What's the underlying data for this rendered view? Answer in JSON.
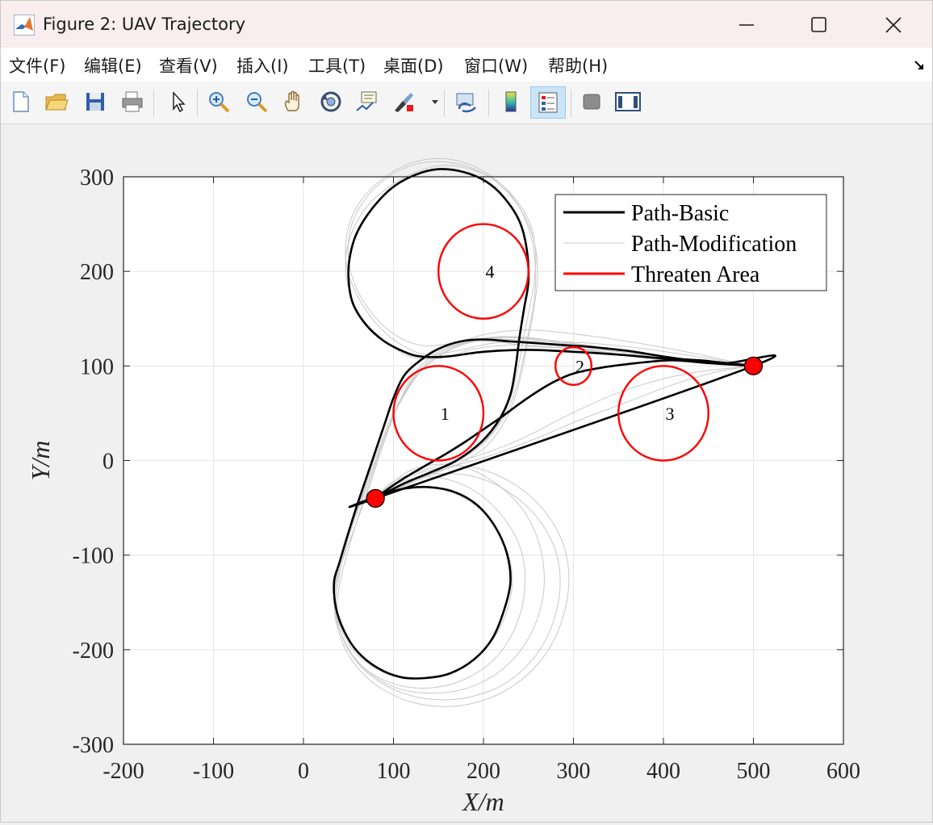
{
  "window": {
    "title": "Figure 2: UAV Trajectory"
  },
  "menu": [
    "文件(F)",
    "编辑(E)",
    "查看(V)",
    "插入(I)",
    "工具(T)",
    "桌面(D)",
    "窗口(W)",
    "帮助(H)"
  ],
  "toolbar": [
    "new-file-icon",
    "open-folder-icon",
    "save-icon",
    "print-icon",
    "pointer-icon",
    "zoom-in-icon",
    "zoom-out-icon",
    "pan-hand-icon",
    "rotate-3d-icon",
    "data-cursor-icon",
    "brush-icon",
    "link-plot-icon",
    "colorbar-icon",
    "legend-icon",
    "hide-plot-tools-icon",
    "show-plot-tools-icon"
  ],
  "chart_data": {
    "type": "line",
    "xlabel": "X/m",
    "ylabel": "Y/m",
    "xlim": [
      -200,
      600
    ],
    "ylim": [
      -300,
      300
    ],
    "xticks": [
      -200,
      -100,
      0,
      100,
      200,
      300,
      400,
      500,
      600
    ],
    "yticks": [
      -300,
      -200,
      -100,
      0,
      100,
      200,
      300
    ],
    "grid": true,
    "legend_position": "top-right",
    "legend": [
      {
        "label": "Path-Basic",
        "color": "#000000"
      },
      {
        "label": "Path-Modification",
        "color": "#c8c8c8"
      },
      {
        "label": "Threaten Area",
        "color": "#ff0000"
      }
    ],
    "threat_areas": [
      {
        "label": "1",
        "x": 150,
        "y": 50,
        "r": 50
      },
      {
        "label": "2",
        "x": 300,
        "y": 100,
        "r": 20
      },
      {
        "label": "3",
        "x": 400,
        "y": 50,
        "r": 50
      },
      {
        "label": "4",
        "x": 200,
        "y": 200,
        "r": 50
      }
    ],
    "endpoints": [
      {
        "x": 80,
        "y": -40
      },
      {
        "x": 500,
        "y": 100
      }
    ],
    "path_basic": [
      [
        80,
        -40
      ],
      [
        100,
        -26
      ],
      [
        120,
        -14
      ],
      [
        140,
        -3
      ],
      [
        160,
        8
      ],
      [
        180,
        20
      ],
      [
        200,
        33
      ],
      [
        220,
        46
      ],
      [
        240,
        60
      ],
      [
        260,
        73
      ],
      [
        280,
        84
      ],
      [
        300,
        92
      ],
      [
        330,
        98
      ],
      [
        370,
        103
      ],
      [
        410,
        106
      ],
      [
        450,
        103
      ],
      [
        500,
        100
      ],
      [
        500,
        100
      ],
      [
        470,
        103
      ],
      [
        440,
        105
      ],
      [
        400,
        110
      ],
      [
        360,
        116
      ],
      [
        320,
        120
      ],
      [
        290,
        122
      ],
      [
        260,
        124
      ],
      [
        230,
        126
      ],
      [
        200,
        128
      ],
      [
        175,
        126
      ],
      [
        150,
        118
      ],
      [
        130,
        106
      ],
      [
        112,
        90
      ],
      [
        100,
        66
      ],
      [
        90,
        38
      ],
      [
        80,
        10
      ],
      [
        70,
        -18
      ],
      [
        60,
        -46
      ],
      [
        50,
        -76
      ],
      [
        40,
        -108
      ],
      [
        34,
        -128
      ],
      [
        36,
        -155
      ],
      [
        45,
        -180
      ],
      [
        60,
        -202
      ],
      [
        82,
        -219
      ],
      [
        108,
        -229
      ],
      [
        135,
        -230
      ],
      [
        163,
        -225
      ],
      [
        190,
        -210
      ],
      [
        210,
        -188
      ],
      [
        223,
        -158
      ],
      [
        230,
        -128
      ],
      [
        226,
        -98
      ],
      [
        213,
        -70
      ],
      [
        193,
        -47
      ],
      [
        167,
        -33
      ],
      [
        137,
        -28
      ],
      [
        110,
        -30
      ],
      [
        90,
        -35
      ],
      [
        80,
        -40
      ],
      [
        500,
        100
      ],
      [
        470,
        103
      ],
      [
        440,
        106
      ],
      [
        400,
        108
      ],
      [
        350,
        112
      ],
      [
        300,
        115
      ],
      [
        250,
        117
      ],
      [
        200,
        115
      ],
      [
        160,
        110
      ],
      [
        130,
        110
      ],
      [
        112,
        115
      ],
      [
        90,
        126
      ],
      [
        70,
        143
      ],
      [
        55,
        166
      ],
      [
        50,
        193
      ],
      [
        52,
        218
      ],
      [
        60,
        242
      ],
      [
        76,
        266
      ],
      [
        98,
        288
      ],
      [
        124,
        302
      ],
      [
        150,
        308
      ],
      [
        178,
        305
      ],
      [
        203,
        295
      ],
      [
        223,
        278
      ],
      [
        240,
        253
      ],
      [
        248,
        224
      ],
      [
        250,
        190
      ],
      [
        245,
        160
      ],
      [
        240,
        130
      ],
      [
        236,
        100
      ],
      [
        230,
        70
      ],
      [
        218,
        44
      ],
      [
        198,
        20
      ],
      [
        170,
        0
      ],
      [
        140,
        -13
      ],
      [
        110,
        -25
      ],
      [
        80,
        -40
      ]
    ],
    "path_modification": [
      [
        [
          80,
          -40
        ],
        [
          100,
          -30
        ],
        [
          130,
          -28
        ],
        [
          160,
          -32
        ],
        [
          192,
          -48
        ],
        [
          214,
          -72
        ],
        [
          228,
          -100
        ],
        [
          232,
          -130
        ],
        [
          225,
          -162
        ],
        [
          210,
          -190
        ],
        [
          187,
          -212
        ],
        [
          158,
          -226
        ],
        [
          130,
          -230
        ],
        [
          100,
          -228
        ],
        [
          74,
          -216
        ],
        [
          53,
          -198
        ],
        [
          40,
          -172
        ],
        [
          35,
          -142
        ],
        [
          42,
          -110
        ],
        [
          55,
          -76
        ],
        [
          68,
          -42
        ],
        [
          80,
          -8
        ],
        [
          92,
          26
        ],
        [
          105,
          58
        ],
        [
          122,
          90
        ],
        [
          145,
          112
        ],
        [
          175,
          124
        ],
        [
          210,
          126
        ],
        [
          250,
          121
        ],
        [
          300,
          118
        ],
        [
          350,
          112
        ],
        [
          400,
          106
        ],
        [
          450,
          103
        ],
        [
          500,
          100
        ]
      ],
      [
        [
          80,
          -40
        ],
        [
          110,
          -22
        ],
        [
          150,
          -18
        ],
        [
          190,
          -32
        ],
        [
          222,
          -60
        ],
        [
          242,
          -95
        ],
        [
          246,
          -135
        ],
        [
          236,
          -175
        ],
        [
          214,
          -208
        ],
        [
          182,
          -230
        ],
        [
          145,
          -240
        ],
        [
          108,
          -238
        ],
        [
          74,
          -224
        ],
        [
          50,
          -200
        ],
        [
          38,
          -168
        ],
        [
          40,
          -132
        ],
        [
          50,
          -94
        ],
        [
          62,
          -56
        ],
        [
          76,
          -16
        ],
        [
          90,
          24
        ],
        [
          106,
          60
        ],
        [
          126,
          92
        ],
        [
          152,
          114
        ],
        [
          185,
          126
        ],
        [
          230,
          128
        ],
        [
          280,
          122
        ],
        [
          340,
          114
        ],
        [
          400,
          107
        ],
        [
          460,
          102
        ],
        [
          500,
          100
        ]
      ],
      [
        [
          80,
          -40
        ],
        [
          120,
          -10
        ],
        [
          170,
          -5
        ],
        [
          215,
          -25
        ],
        [
          248,
          -58
        ],
        [
          265,
          -100
        ],
        [
          266,
          -145
        ],
        [
          250,
          -188
        ],
        [
          222,
          -220
        ],
        [
          184,
          -240
        ],
        [
          142,
          -246
        ],
        [
          102,
          -240
        ],
        [
          68,
          -220
        ],
        [
          46,
          -192
        ],
        [
          36,
          -158
        ],
        [
          40,
          -120
        ],
        [
          50,
          -82
        ],
        [
          64,
          -44
        ],
        [
          78,
          -6
        ],
        [
          93,
          32
        ],
        [
          110,
          66
        ],
        [
          132,
          96
        ],
        [
          160,
          116
        ],
        [
          195,
          128
        ],
        [
          240,
          130
        ],
        [
          300,
          124
        ],
        [
          360,
          116
        ],
        [
          420,
          108
        ],
        [
          470,
          103
        ],
        [
          500,
          100
        ]
      ],
      [
        [
          80,
          -40
        ],
        [
          140,
          -15
        ],
        [
          200,
          -20
        ],
        [
          250,
          -50
        ],
        [
          280,
          -95
        ],
        [
          284,
          -145
        ],
        [
          266,
          -195
        ],
        [
          230,
          -232
        ],
        [
          185,
          -250
        ],
        [
          138,
          -252
        ],
        [
          96,
          -240
        ],
        [
          62,
          -216
        ],
        [
          42,
          -184
        ],
        [
          34,
          -148
        ],
        [
          40,
          -110
        ],
        [
          52,
          -72
        ],
        [
          66,
          -34
        ],
        [
          80,
          4
        ],
        [
          96,
          42
        ],
        [
          114,
          74
        ],
        [
          138,
          102
        ],
        [
          168,
          120
        ],
        [
          205,
          130
        ],
        [
          250,
          130
        ],
        [
          310,
          122
        ],
        [
          370,
          114
        ],
        [
          430,
          106
        ],
        [
          500,
          100
        ]
      ],
      [
        [
          500,
          100
        ],
        [
          460,
          104
        ],
        [
          400,
          110
        ],
        [
          340,
          116
        ],
        [
          280,
          120
        ],
        [
          230,
          122
        ],
        [
          190,
          118
        ],
        [
          150,
          108
        ],
        [
          118,
          110
        ],
        [
          88,
          128
        ],
        [
          64,
          152
        ],
        [
          50,
          182
        ],
        [
          47,
          214
        ],
        [
          55,
          244
        ],
        [
          72,
          270
        ],
        [
          96,
          290
        ],
        [
          125,
          305
        ],
        [
          155,
          312
        ],
        [
          186,
          308
        ],
        [
          214,
          296
        ],
        [
          236,
          276
        ],
        [
          252,
          250
        ],
        [
          258,
          218
        ],
        [
          256,
          186
        ],
        [
          250,
          156
        ],
        [
          244,
          126
        ],
        [
          238,
          96
        ],
        [
          230,
          66
        ],
        [
          216,
          38
        ],
        [
          194,
          14
        ],
        [
          164,
          -4
        ],
        [
          130,
          -18
        ],
        [
          100,
          -30
        ],
        [
          80,
          -40
        ]
      ],
      [
        [
          500,
          100
        ],
        [
          450,
          108
        ],
        [
          380,
          118
        ],
        [
          320,
          124
        ],
        [
          260,
          126
        ],
        [
          210,
          124
        ],
        [
          170,
          116
        ],
        [
          136,
          112
        ],
        [
          106,
          124
        ],
        [
          80,
          146
        ],
        [
          60,
          174
        ],
        [
          48,
          206
        ],
        [
          48,
          238
        ],
        [
          58,
          266
        ],
        [
          78,
          290
        ],
        [
          104,
          308
        ],
        [
          134,
          318
        ],
        [
          166,
          318
        ],
        [
          196,
          308
        ],
        [
          222,
          290
        ],
        [
          242,
          264
        ],
        [
          254,
          232
        ],
        [
          258,
          198
        ],
        [
          256,
          166
        ],
        [
          250,
          136
        ],
        [
          244,
          106
        ],
        [
          236,
          76
        ],
        [
          224,
          48
        ],
        [
          204,
          22
        ],
        [
          176,
          2
        ],
        [
          144,
          -12
        ],
        [
          112,
          -26
        ],
        [
          80,
          -40
        ]
      ],
      [
        [
          500,
          100
        ],
        [
          470,
          106
        ],
        [
          420,
          116
        ],
        [
          360,
          126
        ],
        [
          300,
          134
        ],
        [
          250,
          138
        ],
        [
          205,
          134
        ],
        [
          165,
          124
        ],
        [
          130,
          122
        ],
        [
          100,
          134
        ],
        [
          76,
          156
        ],
        [
          58,
          184
        ],
        [
          50,
          214
        ],
        [
          52,
          244
        ],
        [
          64,
          270
        ],
        [
          86,
          294
        ],
        [
          114,
          310
        ],
        [
          146,
          316
        ],
        [
          178,
          312
        ],
        [
          206,
          300
        ],
        [
          230,
          280
        ],
        [
          248,
          254
        ],
        [
          258,
          224
        ],
        [
          260,
          192
        ],
        [
          256,
          160
        ],
        [
          250,
          130
        ],
        [
          244,
          100
        ],
        [
          236,
          70
        ],
        [
          224,
          42
        ],
        [
          204,
          16
        ],
        [
          176,
          -2
        ],
        [
          144,
          -14
        ],
        [
          110,
          -28
        ],
        [
          80,
          -40
        ]
      ],
      [
        [
          80,
          -40
        ],
        [
          100,
          -22
        ],
        [
          140,
          -8
        ],
        [
          190,
          4
        ],
        [
          240,
          22
        ],
        [
          290,
          46
        ],
        [
          340,
          68
        ],
        [
          390,
          84
        ],
        [
          440,
          94
        ],
        [
          500,
          100
        ]
      ],
      [
        [
          80,
          -40
        ],
        [
          110,
          -24
        ],
        [
          160,
          -8
        ],
        [
          210,
          6
        ],
        [
          260,
          24
        ],
        [
          310,
          44
        ],
        [
          360,
          62
        ],
        [
          410,
          80
        ],
        [
          460,
          94
        ],
        [
          500,
          100
        ]
      ],
      [
        [
          80,
          -40
        ],
        [
          120,
          -16
        ],
        [
          180,
          -6
        ],
        [
          236,
          -26
        ],
        [
          276,
          -64
        ],
        [
          294,
          -110
        ],
        [
          290,
          -160
        ],
        [
          268,
          -206
        ],
        [
          230,
          -240
        ],
        [
          182,
          -258
        ],
        [
          132,
          -258
        ],
        [
          88,
          -242
        ],
        [
          56,
          -214
        ],
        [
          38,
          -178
        ],
        [
          34,
          -140
        ],
        [
          42,
          -102
        ],
        [
          56,
          -62
        ],
        [
          72,
          -22
        ],
        [
          88,
          20
        ],
        [
          104,
          56
        ],
        [
          124,
          88
        ],
        [
          150,
          110
        ],
        [
          182,
          124
        ],
        [
          220,
          130
        ],
        [
          270,
          126
        ],
        [
          330,
          118
        ],
        [
          390,
          110
        ],
        [
          450,
          104
        ],
        [
          500,
          100
        ]
      ]
    ]
  }
}
